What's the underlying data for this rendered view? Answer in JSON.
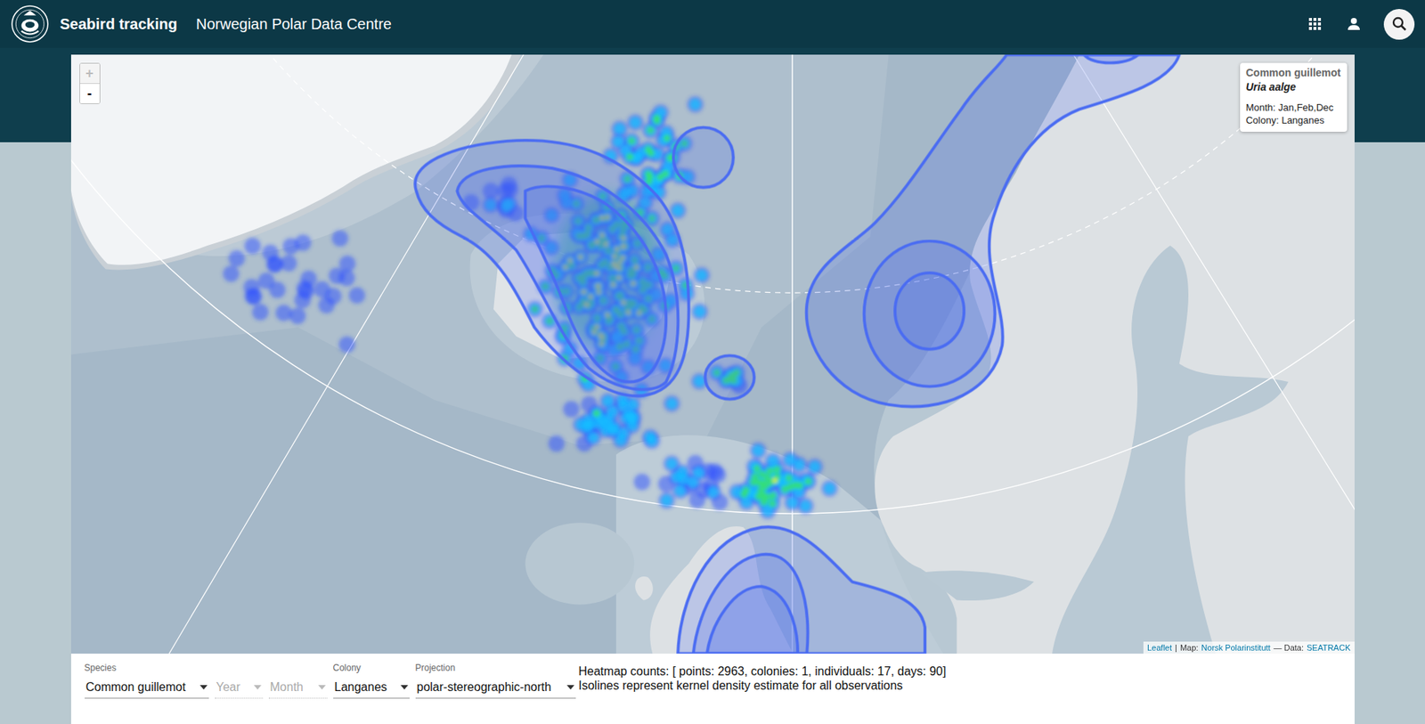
{
  "header": {
    "title": "Seabird tracking",
    "subtitle": "Norwegian Polar Data Centre"
  },
  "zoom": [
    {
      "label": "+",
      "disabled": true
    },
    {
      "label": "-",
      "disabled": false
    }
  ],
  "legend": {
    "common_name": "Common guillemot",
    "latin_name": "Uria aalge",
    "lines": [
      "Month: Jan,Feb,Dec",
      "Colony: Langanes"
    ]
  },
  "attribution": [
    {
      "text": "Leaflet",
      "link": true
    },
    {
      "text": "|",
      "link": false
    },
    {
      "text": "Map:",
      "link": false
    },
    {
      "text": "Norsk Polarinstitutt",
      "link": true
    },
    {
      "text": "— Data:",
      "link": false
    },
    {
      "text": "SEATRACK",
      "link": true
    }
  ],
  "filters": [
    {
      "label": "Species",
      "text": "Common guillemot",
      "disabled": false
    },
    {
      "label": "",
      "text": "Year",
      "disabled": true
    },
    {
      "label": "",
      "text": "Month",
      "disabled": true
    },
    {
      "label": "Colony",
      "text": "Langanes",
      "disabled": false
    },
    {
      "label": "Projection",
      "text": "polar-stereographic-north",
      "disabled": false
    }
  ],
  "info": [
    "Heatmap counts: [ points: 2963, colonies: 1, individuals: 17, days: 90]",
    "Isolines represent kernel density estimate for all observations"
  ]
}
